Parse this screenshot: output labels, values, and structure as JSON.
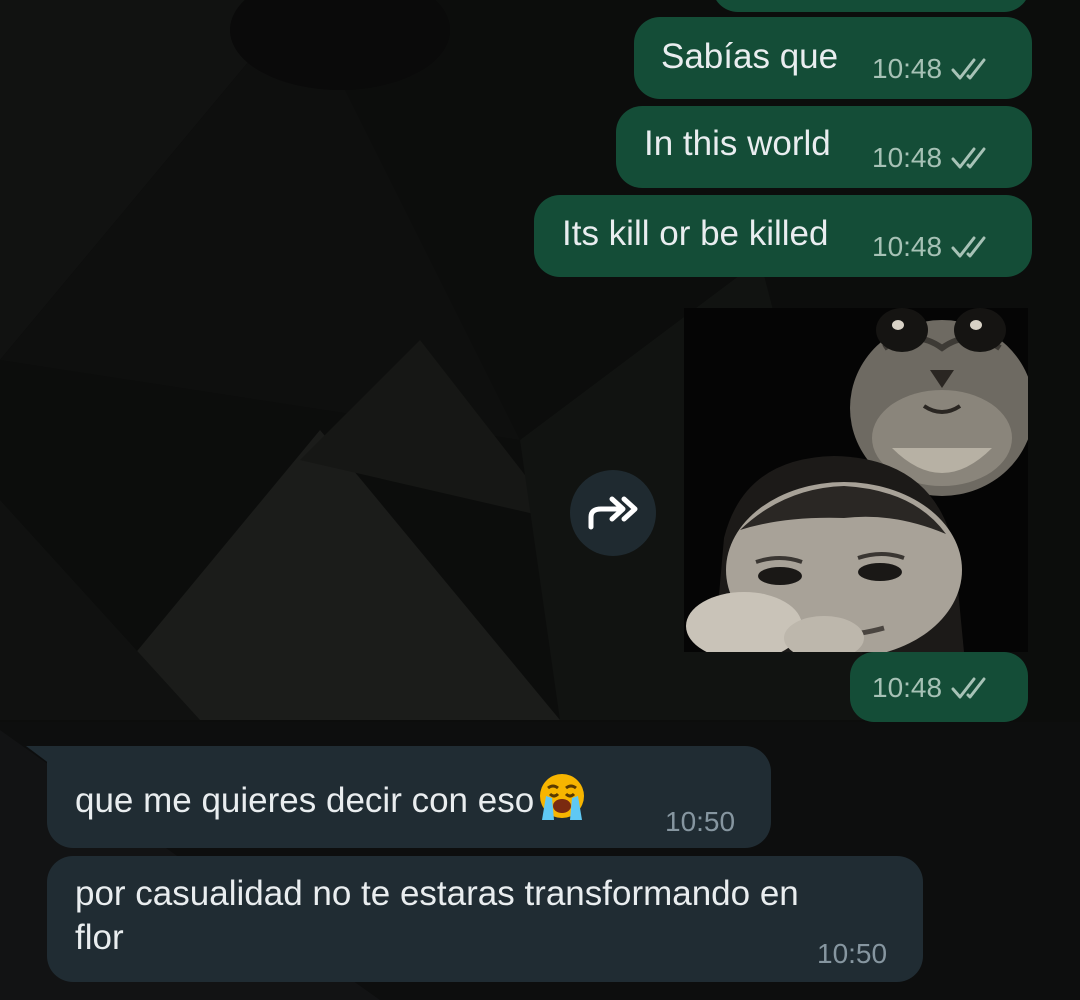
{
  "colors": {
    "outgoing_bubble": "#144d37",
    "incoming_bubble": "#202c33",
    "read_ticks": "#a7c2b6",
    "wallpaper": "#0c0d0c"
  },
  "messages": {
    "out1": {
      "text": "Sabías que",
      "time": "10:48",
      "status_icon": "double-check-icon"
    },
    "out2": {
      "text": "In this world",
      "time": "10:48",
      "status_icon": "double-check-icon"
    },
    "out3": {
      "text": "Its kill or be killed",
      "time": "10:48",
      "status_icon": "double-check-icon"
    },
    "image_msg": {
      "time": "10:48",
      "status_icon": "double-check-icon",
      "media_icon": "forward-icon"
    },
    "in1": {
      "text": "que me quieres decir con eso",
      "emoji": "loudly-crying-face-emoji",
      "time": "10:50"
    },
    "in2": {
      "line1": "por casualidad no te estaras transformando en",
      "line2": "flor",
      "time": "10:50"
    }
  }
}
